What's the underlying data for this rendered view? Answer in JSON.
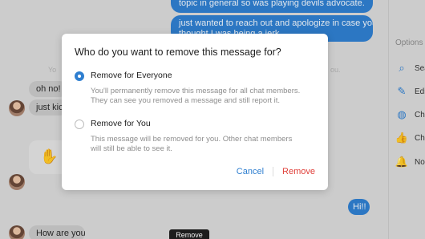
{
  "chat": {
    "outgoing": [
      {
        "text": "topic in general so was playing devils advocate."
      },
      {
        "text": "just wanted to reach out and apologize in case you"
      },
      {
        "text": "thought I was being a jerk"
      },
      {
        "text": "Hi!!"
      }
    ],
    "incoming": [
      {
        "text": "oh no! h"
      },
      {
        "text": "just kick"
      },
      {
        "text": "How are you?"
      }
    ],
    "faint_left": "Yo",
    "faint_right": "ou."
  },
  "sidebar": {
    "heading": "Options",
    "items": [
      {
        "label": "Sea",
        "icon": "search-icon",
        "glyph": "⌕"
      },
      {
        "label": "Edi",
        "icon": "pencil-icon",
        "glyph": "✎"
      },
      {
        "label": "Ch",
        "icon": "palette-icon",
        "glyph": "◍"
      },
      {
        "label": "Ch",
        "icon": "thumbs-up-icon",
        "glyph": "👍"
      },
      {
        "label": "No",
        "icon": "bell-icon",
        "glyph": "🔔"
      }
    ]
  },
  "tooltip": {
    "text": "Remove"
  },
  "dialog": {
    "title": "Who do you want to remove this message for?",
    "options": [
      {
        "label": "Remove for Everyone",
        "selected": true,
        "description_line1": "You'll permanently remove this message for all chat members.",
        "description_line2": "They can see you removed a message and still report it."
      },
      {
        "label": "Remove for You",
        "selected": false,
        "description_line1": "This message will be removed for you. Other chat members",
        "description_line2": "will still be able to see it."
      }
    ],
    "cancel_label": "Cancel",
    "remove_label": "Remove",
    "colors": {
      "accent": "#2f7fd0",
      "danger": "#e0403a"
    }
  }
}
